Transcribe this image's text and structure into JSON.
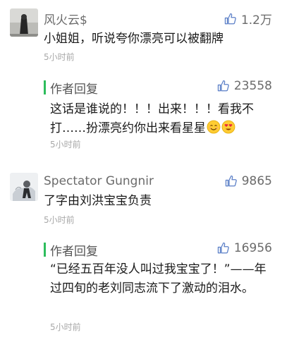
{
  "comments": [
    {
      "author": "风火云$",
      "likes": "1.2万",
      "text": "小姐姐，听说夸你漂亮可以被翻牌",
      "time": "5小时前",
      "reply": {
        "label": "作者回复",
        "likes": "23558",
        "text": "这话是谁说的！！！出来！！！看我不打……扮漂亮约你出来看星星",
        "emojis": [
          "smiling-face-icon",
          "heart-eyes-face-icon"
        ],
        "time": "5小时前"
      }
    },
    {
      "author": "Spectator Gungnir",
      "likes": "9865",
      "text": "了字由刘洪宝宝负责",
      "time": "5小时前",
      "reply": {
        "label": "作者回复",
        "likes": "16956",
        "text": "“已经五百年没人叫过我宝宝了！”——年过四旬的老刘同志流下了激动的泪水。",
        "time": "5小时前"
      }
    }
  ],
  "colors": {
    "reply_bar": "#2dbd5c",
    "meta_text": "#a8a8a8",
    "name_text": "#6b6b6b"
  }
}
